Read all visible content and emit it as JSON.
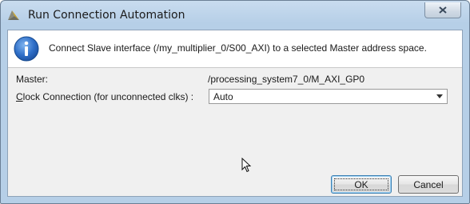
{
  "window": {
    "title": "Run Connection Automation"
  },
  "info": {
    "message": "Connect Slave interface (/my_multiplier_0/S00_AXI) to a selected Master address space."
  },
  "master": {
    "label": "Master:",
    "value": "/processing_system7_0/M_AXI_GP0"
  },
  "clock": {
    "label_first_char": "C",
    "label_rest": "lock Connection (for unconnected clks) :",
    "selected": "Auto"
  },
  "buttons": {
    "ok": "OK",
    "cancel": "Cancel"
  },
  "icons": {
    "app": "vivado-logo-icon",
    "close": "close-icon",
    "info": "info-icon",
    "dropdown": "chevron-down-icon",
    "cursor": "mouse-cursor-icon"
  }
}
